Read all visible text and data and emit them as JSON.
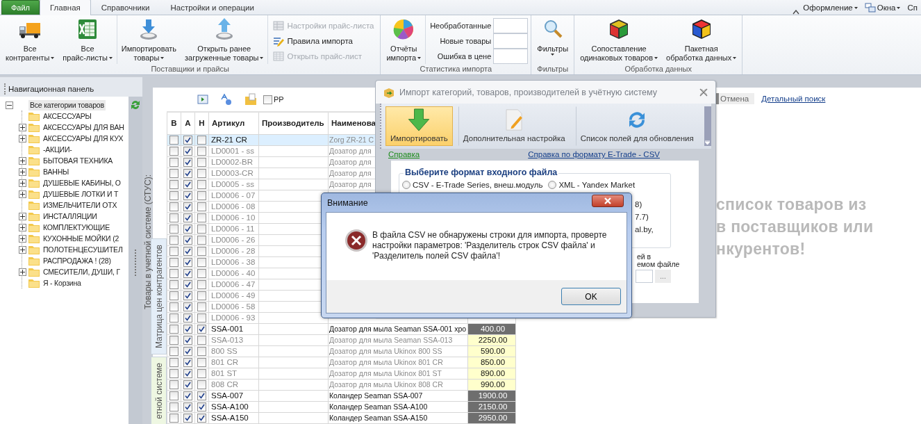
{
  "tab_bar": {
    "file_button": "Файл",
    "tabs": [
      {
        "label": "Главная",
        "selected": true
      },
      {
        "label": "Справочники",
        "selected": false
      },
      {
        "label": "Настройки и операции",
        "selected": false
      }
    ],
    "right_menus": [
      {
        "label": "Оформление",
        "kind": "menu"
      },
      {
        "label": "Окна",
        "kind": "windows"
      },
      {
        "label": "Сп",
        "kind": "plain"
      }
    ]
  },
  "ribbon": {
    "groups": [
      {
        "label": "Поставщики и прайсы",
        "clusters": [
          [
            {
              "kind": "large",
              "lines": [
                "Все",
                "контрагенты"
              ],
              "dropdown": true
            },
            {
              "kind": "large",
              "lines": [
                "Все",
                "прайс-листы"
              ],
              "dropdown": true
            }
          ],
          [
            {
              "kind": "large",
              "lines": [
                "Импортировать",
                "товары"
              ],
              "dropdown": true
            },
            {
              "kind": "large",
              "lines": [
                "Открыть ранее",
                "загруженные товары"
              ],
              "dropdown": true
            }
          ],
          [
            {
              "kind": "small_stack",
              "items": [
                {
                  "label": "Настройки прайс-листа",
                  "disabled": true
                },
                {
                  "label": "Правила импорта",
                  "disabled": false
                },
                {
                  "label": "Открыть прайс-лист",
                  "disabled": true
                }
              ]
            }
          ]
        ]
      },
      {
        "label": "Статистика импорта",
        "clusters": [
          [
            {
              "kind": "large",
              "lines": [
                "Отчёты",
                "импорта"
              ],
              "dropdown": true
            }
          ],
          [
            {
              "kind": "counters",
              "rows": [
                {
                  "label": "Необработанные"
                },
                {
                  "label": "Новые товары"
                },
                {
                  "label": "Ошибка в цене"
                }
              ]
            }
          ]
        ]
      },
      {
        "label": "Фильтры",
        "clusters": [
          [
            {
              "kind": "large",
              "lines": [
                "Фильтры"
              ],
              "dropdown": true
            }
          ]
        ]
      },
      {
        "label": "Обработка данных",
        "clusters": [
          [
            {
              "kind": "large",
              "lines": [
                "Сопоставление",
                "одинаковых товаров"
              ],
              "dropdown": true
            },
            {
              "kind": "large",
              "lines": [
                "Пакетная",
                "обработка данных"
              ],
              "dropdown": true
            }
          ]
        ]
      }
    ]
  },
  "navigation": {
    "title": "Навигационная панель",
    "tree": [
      {
        "label": "Все категории товаров",
        "selected": true,
        "expanded": true,
        "children": [
          {
            "label": "АКСЕССУАРЫ",
            "expandable": false,
            "selected": false
          },
          {
            "label": "АКСЕССУАРЫ ДЛЯ ВАН",
            "expandable": true,
            "selected": false
          },
          {
            "label": "АКСЕССУАРЫ ДЛЯ КУХ",
            "expandable": true,
            "selected": false
          },
          {
            "label": "-АКЦИИ-",
            "expandable": false,
            "selected": false
          },
          {
            "label": "БЫТОВАЯ ТЕХНИКА",
            "expandable": true,
            "selected": false
          },
          {
            "label": "ВАННЫ",
            "expandable": true,
            "selected": false
          },
          {
            "label": "ДУШЕВЫЕ КАБИНЫ, О",
            "expandable": true,
            "selected": false
          },
          {
            "label": "ДУШЕВЫЕ ЛОТКИ И Т",
            "expandable": true,
            "selected": false
          },
          {
            "label": "ИЗМЕЛЬЧИТЕЛИ ОТХ",
            "expandable": false,
            "selected": false
          },
          {
            "label": "ИНСТАЛЛЯЦИИ",
            "expandable": true,
            "selected": false
          },
          {
            "label": "КОМПЛЕКТУЮЩИЕ",
            "expandable": true,
            "selected": false
          },
          {
            "label": "КУХОННЫЕ МОЙКИ (2",
            "expandable": true,
            "selected": false
          },
          {
            "label": "ПОЛОТЕНЦЕСУШИТЕЛ",
            "expandable": true,
            "selected": false
          },
          {
            "label": "РАСПРОДАЖА ! (28)",
            "expandable": false,
            "selected": false
          },
          {
            "label": "СМЕСИТЕЛИ, ДУШИ, Г",
            "expandable": true,
            "selected": false
          },
          {
            "label": "Я - Корзина",
            "expandable": false,
            "selected": false
          }
        ]
      }
    ]
  },
  "products": {
    "side_title": "Товары в учетной системе (СТУС):",
    "side_tabs": [
      {
        "label": "Матрица цен контрагентов",
        "selected": false
      },
      {
        "label": "етной системе",
        "selected": true
      }
    ],
    "toolbar_checkbox": {
      "label": "РР",
      "checked": false
    },
    "columns": [
      "В",
      "А",
      "Н",
      "Артикул",
      "Производитель",
      "Наименова"
    ],
    "rows": [
      {
        "b": false,
        "a": true,
        "n": false,
        "selected": true,
        "article": "ZR-21 CR",
        "name": "Zorg ZR-21 C"
      },
      {
        "b": false,
        "a": true,
        "n": false,
        "selected": false,
        "article": "LD0001 - ss",
        "name": "Дозатор для"
      },
      {
        "b": false,
        "a": true,
        "n": false,
        "selected": false,
        "article": "LD0002-BR",
        "name": "Дозатор для"
      },
      {
        "b": false,
        "a": true,
        "n": false,
        "selected": false,
        "article": "LD0003-CR",
        "name": "Дозатор для"
      },
      {
        "b": false,
        "a": true,
        "n": false,
        "selected": false,
        "article": "LD0005 - ss",
        "name": "Дозатор для"
      },
      {
        "b": false,
        "a": true,
        "n": false,
        "selected": false,
        "article": "LD0006 - 07"
      },
      {
        "b": false,
        "a": true,
        "n": false,
        "selected": false,
        "article": "LD0006 - 08"
      },
      {
        "b": false,
        "a": true,
        "n": false,
        "selected": false,
        "article": "LD0006 - 10"
      },
      {
        "b": false,
        "a": true,
        "n": false,
        "selected": false,
        "article": "LD0006 - 11"
      },
      {
        "b": false,
        "a": true,
        "n": false,
        "selected": false,
        "article": "LD0006 - 26"
      },
      {
        "b": false,
        "a": true,
        "n": false,
        "selected": false,
        "article": "LD0006 - 28"
      },
      {
        "b": false,
        "a": true,
        "n": false,
        "selected": false,
        "article": "LD0006 - 38"
      },
      {
        "b": false,
        "a": true,
        "n": false,
        "selected": false,
        "article": "LD0006 - 40"
      },
      {
        "b": false,
        "a": true,
        "n": false,
        "selected": false,
        "article": "LD0006 - 47"
      },
      {
        "b": false,
        "a": true,
        "n": false,
        "selected": false,
        "article": "LD0006 - 49"
      },
      {
        "b": false,
        "a": true,
        "n": false,
        "selected": false,
        "article": "LD0006 - 58"
      },
      {
        "b": false,
        "a": true,
        "n": false,
        "selected": false,
        "article": "LD0006 - 93"
      },
      {
        "b": false,
        "a": true,
        "n": true,
        "selected": false,
        "article": "SSA-001",
        "name": "Дозатор для мыла Seaman SSA-001 хро",
        "price": "400.00"
      },
      {
        "b": false,
        "a": true,
        "n": false,
        "selected": false,
        "article": "SSA-013",
        "name": "Дозатор для мыла Seaman SSA-013",
        "price": "2250.00"
      },
      {
        "b": false,
        "a": true,
        "n": false,
        "selected": false,
        "article": "800 SS",
        "name": "Дозатор для мыла Ukinox 800 SS",
        "price": "590.00"
      },
      {
        "b": false,
        "a": true,
        "n": false,
        "selected": false,
        "article": "801 CR",
        "name": "Дозатор для мыла Ukinox 801 CR",
        "price": "850.00"
      },
      {
        "b": false,
        "a": true,
        "n": false,
        "selected": false,
        "article": "801 ST",
        "name": "Дозатор для мыла Ukinox 801 ST",
        "price": "890.00"
      },
      {
        "b": false,
        "a": true,
        "n": false,
        "selected": false,
        "article": "808 CR",
        "name": "Дозатор для мыла Ukinox 808 CR",
        "price": "990.00"
      },
      {
        "b": false,
        "a": true,
        "n": true,
        "selected": false,
        "article": "SSA-007",
        "name": "Коландер Seaman SSA-007",
        "price": "1900.00"
      },
      {
        "b": false,
        "a": true,
        "n": true,
        "selected": false,
        "article": "SSA-A100",
        "name": "Коландер Seaman SSA-A100",
        "price": "2150.00"
      },
      {
        "b": false,
        "a": true,
        "n": true,
        "selected": false,
        "article": "SSA-A150",
        "name": "Коландер Seaman SSA-A150",
        "price": "2950.00"
      }
    ]
  },
  "search_area": {
    "cancel_button": "Отмена",
    "search_link": "Детальный поиск",
    "hint": "список товаров из\nв поставщиков или\nнкурентов!"
  },
  "import_dialog": {
    "title": "Импорт категорий, товаров, производителей в учётную систему",
    "toolbar": [
      {
        "label": "Импортировать",
        "highlighted": true
      },
      {
        "label": "Дополнительная настройка",
        "highlighted": false
      },
      {
        "label": "Список полей для обновления",
        "highlighted": false
      }
    ],
    "help_link": "Справка",
    "format_link": "Справка по формату E-Trade - CSV",
    "format_group": {
      "title": "Выберите формат входного файла",
      "options": [
        {
          "label": "CSV - E-Trade Series, внеш.модуль",
          "selected": false
        },
        {
          "label": "XML - Yandex Market",
          "selected": false
        }
      ],
      "fragments": [
        "8)",
        "7.7)",
        "al.by,"
      ]
    },
    "label_fragments": [
      "ей в",
      "емом файле"
    ],
    "browse_button": "..."
  },
  "alert": {
    "title": "Внимание",
    "message": "В файла CSV не обнаружены строки для импорта, проверте\nнастройки параметров: 'Разделитель строк CSV файла' и\n'Разделитель полей CSV файла'!",
    "button": "OK"
  }
}
